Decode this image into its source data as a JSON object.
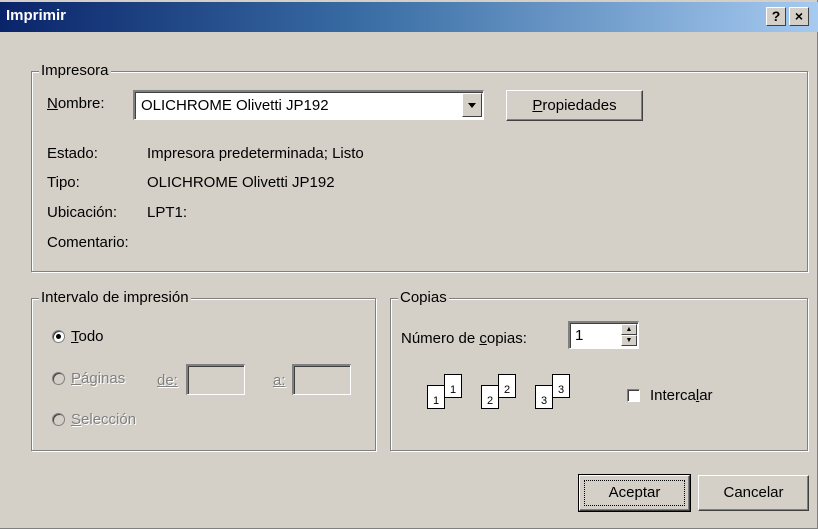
{
  "window": {
    "title": "Imprimir",
    "help_label": "?",
    "close_label": "×"
  },
  "printer": {
    "group_label": "Impresora",
    "name_label_first": "N",
    "name_label_rest": "ombre:",
    "name_value": "OLICHROME Olivetti JP192",
    "properties_first": "P",
    "properties_rest": "ropiedades",
    "status_label": "Estado:",
    "status_value": "Impresora predeterminada; Listo",
    "type_label": "Tipo:",
    "type_value": "OLICHROME Olivetti JP192",
    "location_label": "Ubicación:",
    "location_value": "LPT1:",
    "comment_label": "Comentario:",
    "comment_value": ""
  },
  "range": {
    "group_label": "Intervalo de impresión",
    "all_first": "T",
    "all_rest": "odo",
    "pages_first": "P",
    "pages_rest": "áginas",
    "from_label": "de:",
    "to_label": "a:",
    "selection_first": "S",
    "selection_rest": "elección",
    "selected": "all"
  },
  "copies": {
    "group_label": "Copias",
    "count_label_before": "Número de ",
    "count_label_u": "c",
    "count_label_after": "opias:",
    "count_value": "1",
    "collate_before": "Interca",
    "collate_u": "l",
    "collate_after": "ar",
    "collate_checked": false,
    "pages": [
      "1",
      "2",
      "3"
    ]
  },
  "buttons": {
    "ok": "Aceptar",
    "cancel": "Cancelar"
  }
}
